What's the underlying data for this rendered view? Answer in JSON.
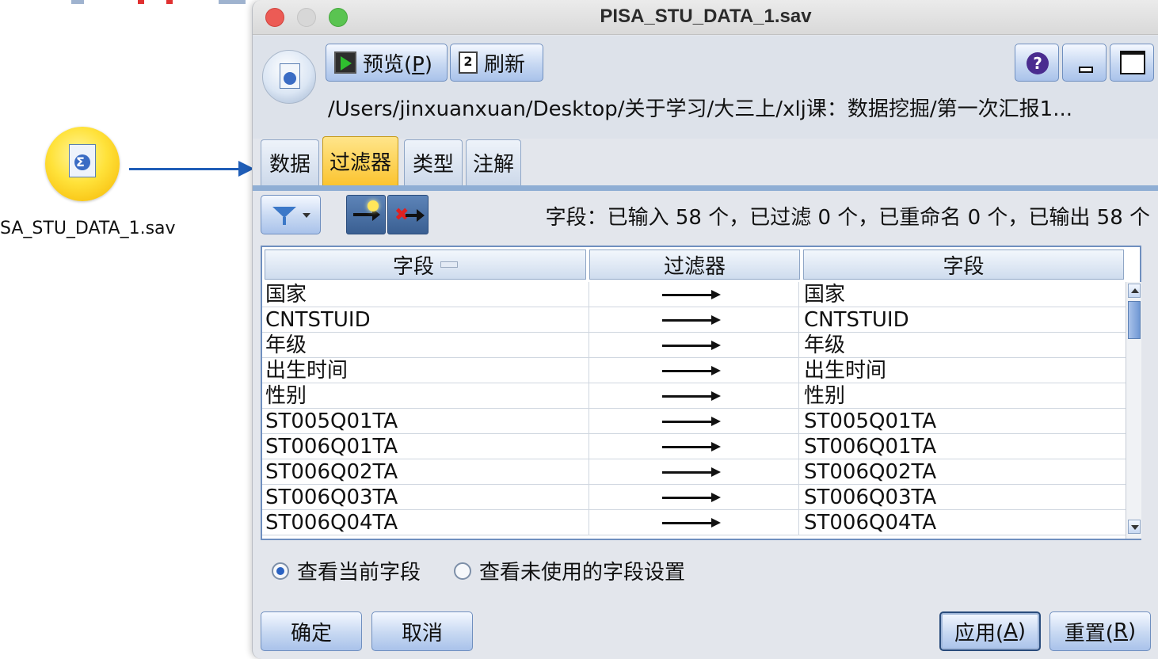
{
  "canvas": {
    "node_label": "SA_STU_DATA_1.sav",
    "node_icon": "sigma-document-icon",
    "link_icon": "arrow-right-icon"
  },
  "window": {
    "title": "PISA_STU_DATA_1.sav"
  },
  "toolbar": {
    "preview_label": "预览(",
    "preview_mnemonic": "P",
    "preview_suffix": ")",
    "refresh_label": "刷新",
    "help_glyph": "?"
  },
  "file_path": "/Users/jinxuanxuan/Desktop/关于学习/大三上/xlj课：数据挖掘/第一次汇报1...",
  "tabs": [
    {
      "label": "数据",
      "active": false
    },
    {
      "label": "过滤器",
      "active": true
    },
    {
      "label": "类型",
      "active": false
    },
    {
      "label": "注解",
      "active": false
    }
  ],
  "filter_bar": {
    "summary": "字段：已输入 58 个，已过滤 0 个，已重命名 0 个，已输出 58 个"
  },
  "table": {
    "headers": [
      "字段",
      "过滤器",
      "字段"
    ],
    "rows": [
      {
        "in": "国家",
        "out": "国家",
        "filtered": false
      },
      {
        "in": "CNTSTUID",
        "out": "CNTSTUID",
        "filtered": false
      },
      {
        "in": "年级",
        "out": "年级",
        "filtered": false
      },
      {
        "in": "出生时间",
        "out": "出生时间",
        "filtered": false
      },
      {
        "in": "性别",
        "out": "性别",
        "filtered": false
      },
      {
        "in": "ST005Q01TA",
        "out": "ST005Q01TA",
        "filtered": false
      },
      {
        "in": "ST006Q01TA",
        "out": "ST006Q01TA",
        "filtered": false
      },
      {
        "in": "ST006Q02TA",
        "out": "ST006Q02TA",
        "filtered": false
      },
      {
        "in": "ST006Q03TA",
        "out": "ST006Q03TA",
        "filtered": false
      },
      {
        "in": "ST006Q04TA",
        "out": "ST006Q04TA",
        "filtered": false
      }
    ]
  },
  "view_options": {
    "current_label": "查看当前字段",
    "unused_label": "查看未使用的字段设置",
    "selected": "current"
  },
  "buttons": {
    "ok": "确定",
    "cancel": "取消",
    "apply_prefix": "应用(",
    "apply_mnemonic": "A",
    "apply_suffix": ")",
    "reset_prefix": "重置(",
    "reset_mnemonic": "R",
    "reset_suffix": ")"
  },
  "colors": {
    "active_tab": "#fbc430",
    "accent_blue": "#1f5db7",
    "close": "#ec5b55",
    "zoom": "#5ac451"
  }
}
